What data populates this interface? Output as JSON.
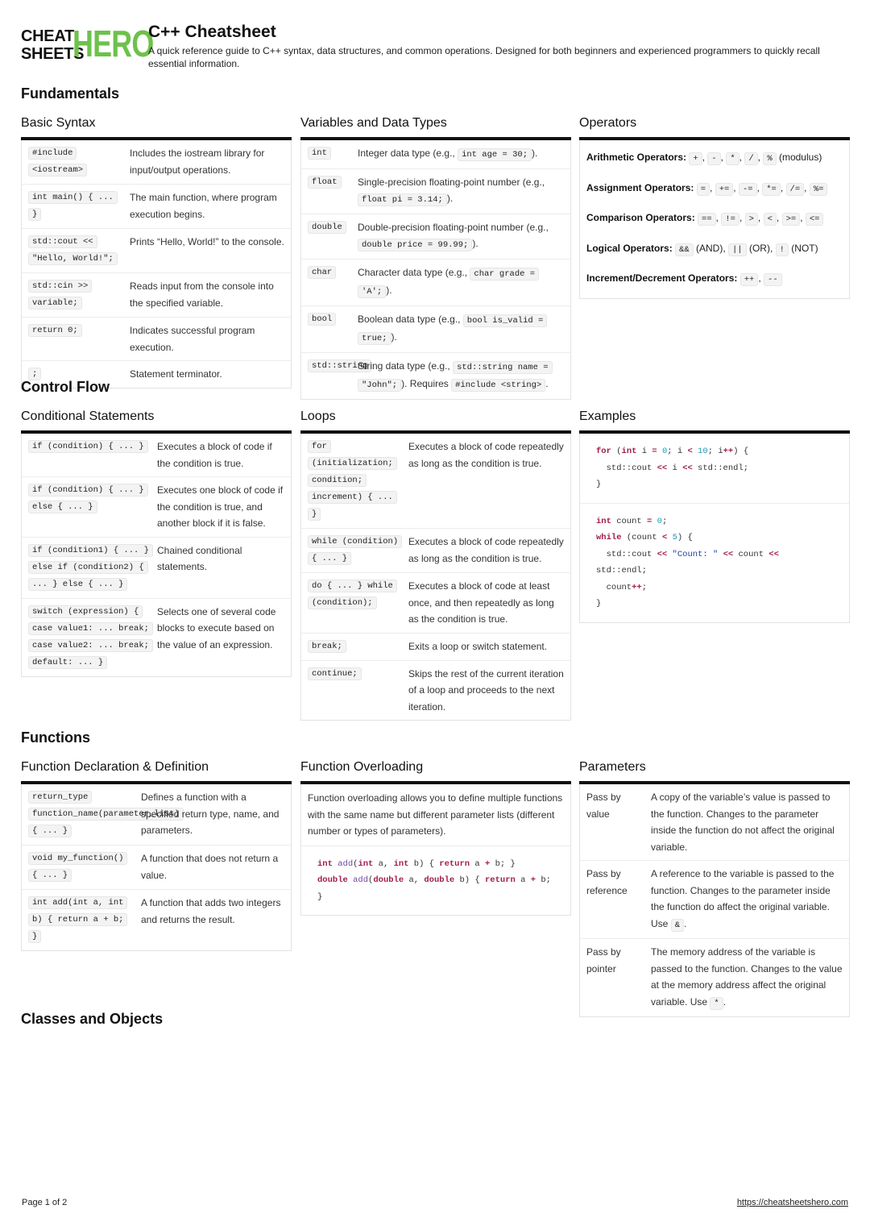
{
  "header": {
    "logo_top": "CHEAT",
    "logo_bottom": "SHEETS",
    "logo_accent": "HERO",
    "title": "C++ Cheatsheet",
    "subtitle": "A quick reference guide to C++ syntax, data structures, and common operations. Designed for both beginners and experienced programmers to quickly recall essential information."
  },
  "colors": {
    "brand_green": "#6cc24a",
    "keyword": "#a11c50",
    "number": "#1f9bb8",
    "string": "#1d3f9f"
  },
  "sections": {
    "fundamentals": "Fundamentals",
    "control_flow": "Control Flow",
    "functions": "Functions",
    "classes": "Classes and Objects"
  },
  "basic_syntax": {
    "title": "Basic Syntax",
    "rows": [
      {
        "code": "#include <iostream>",
        "desc": "Includes the iostream library for input/output operations."
      },
      {
        "code": "int main() { ... }",
        "desc": "The main function, where program execution begins."
      },
      {
        "code": "std::cout << \"Hello, World!\";",
        "desc": "Prints “Hello, World!” to the console."
      },
      {
        "code": "std::cin >> variable;",
        "desc": "Reads input from the console into the specified variable."
      },
      {
        "code": "return 0;",
        "desc": "Indicates successful program execution."
      },
      {
        "code": ";",
        "desc": "Statement terminator."
      }
    ]
  },
  "variables": {
    "title": "Variables and Data Types",
    "rows": [
      {
        "code": "int",
        "desc_pre": "Integer data type (e.g., ",
        "desc_code": "int age = 30;",
        "desc_post": ")."
      },
      {
        "code": "float",
        "desc_pre": "Single-precision floating-point number (e.g., ",
        "desc_code": "float pi = 3.14;",
        "desc_post": ")."
      },
      {
        "code": "double",
        "desc_pre": "Double-precision floating-point number (e.g., ",
        "desc_code": "double price = 99.99;",
        "desc_post": ")."
      },
      {
        "code": "char",
        "desc_pre": "Character data type (e.g., ",
        "desc_code": "char grade = 'A';",
        "desc_post": ")."
      },
      {
        "code": "bool",
        "desc_pre": "Boolean data type (e.g., ",
        "desc_code": "bool is_valid = true;",
        "desc_post": ")."
      },
      {
        "code": "std::string",
        "desc_pre": "String data type (e.g., ",
        "desc_code": "std::string name = \"John\";",
        "desc_post": "). Requires ",
        "desc_code2": "#include <string>",
        "desc_post2": "."
      }
    ]
  },
  "operators": {
    "title": "Operators",
    "lines": [
      {
        "label": "Arithmetic Operators:",
        "ops": [
          "+",
          "-",
          "*",
          "/",
          "%"
        ],
        "suffix": "(modulus)"
      },
      {
        "label": "Assignment Operators:",
        "ops": [
          "=",
          "+=",
          "-=",
          "*=",
          "/=",
          "%="
        ],
        "suffix": ""
      },
      {
        "label": "Comparison Operators:",
        "ops": [
          "==",
          "!=",
          ">",
          "<",
          ">=",
          "<="
        ],
        "suffix": ""
      },
      {
        "label": "Logical Operators:",
        "ops": [
          "&&",
          "||",
          "!"
        ],
        "notes": [
          "(AND),",
          "(OR),",
          "(NOT)"
        ]
      },
      {
        "label": "Increment/Decrement Operators:",
        "ops": [
          "++",
          "--"
        ],
        "suffix": ""
      }
    ]
  },
  "conditionals": {
    "title": "Conditional Statements",
    "rows": [
      {
        "code": "if (condition) { ... }",
        "desc": "Executes a block of code if the condition is true."
      },
      {
        "code": "if (condition) { ... } else { ... }",
        "desc": "Executes one block of code if the condition is true, and another block if it is false."
      },
      {
        "code": "if (condition1) { ... } else if (condition2) { ... } else { ... }",
        "desc": "Chained conditional statements."
      },
      {
        "code": "switch (expression) { case value1: ... break; case value2: ... break; default: ... }",
        "desc": "Selects one of several code blocks to execute based on the value of an expression."
      }
    ]
  },
  "loops": {
    "title": "Loops",
    "rows": [
      {
        "code": "for (initialization; condition; increment) { ... }",
        "desc": "Executes a block of code repeatedly as long as the condition is true."
      },
      {
        "code": "while (condition) { ... }",
        "desc": "Executes a block of code repeatedly as long as the condition is true."
      },
      {
        "code": "do { ... } while (condition);",
        "desc": "Executes a block of code at least once, and then repeatedly as long as the condition is true."
      },
      {
        "code": "break;",
        "desc": "Exits a loop or switch statement."
      },
      {
        "code": "continue;",
        "desc": "Skips the rest of the current iteration of a loop and proceeds to the next iteration."
      }
    ]
  },
  "examples": {
    "title": "Examples",
    "block1": [
      "for (int i = 0; i < 10; i++) {",
      "  std::cout << i << std::endl;",
      "}"
    ],
    "block2": [
      "int count = 0;",
      "while (count < 5) {",
      "  std::cout << \"Count: \" << count <<",
      "std::endl;",
      "  count++;",
      "}"
    ]
  },
  "func_decl": {
    "title": "Function Declaration & Definition",
    "rows": [
      {
        "code": "return_type function_name(parameter_list) { ... }",
        "desc": "Defines a function with a specified return type, name, and parameters."
      },
      {
        "code": "void my_function() { ... }",
        "desc": "A function that does not return a value."
      },
      {
        "code": "int add(int a, int b) { return a + b; }",
        "desc": "A function that adds two integers and returns the result."
      }
    ]
  },
  "overloading": {
    "title": "Function Overloading",
    "description": "Function overloading allows you to define multiple functions with the same name but different parameter lists (different number or types of parameters).",
    "code": [
      "int add(int a, int b) { return a + b; }",
      "double add(double a, double b) { return a + b;",
      "}"
    ]
  },
  "parameters": {
    "title": "Parameters",
    "rows": [
      {
        "term": "Pass by value",
        "desc": "A copy of the variable’s value is passed to the function. Changes to the parameter inside the function do not affect the original variable.",
        "code": ""
      },
      {
        "term": "Pass by reference",
        "desc": "A reference to the variable is passed to the function. Changes to the parameter inside the function do affect the original variable. Use ",
        "code": "&"
      },
      {
        "term": "Pass by pointer",
        "desc": "The memory address of the variable is passed to the function. Changes to the value at the memory address affect the original variable. Use ",
        "code": "*"
      }
    ]
  },
  "footer": {
    "page": "Page 1 of 2",
    "url": "https://cheatsheetshero.com"
  }
}
